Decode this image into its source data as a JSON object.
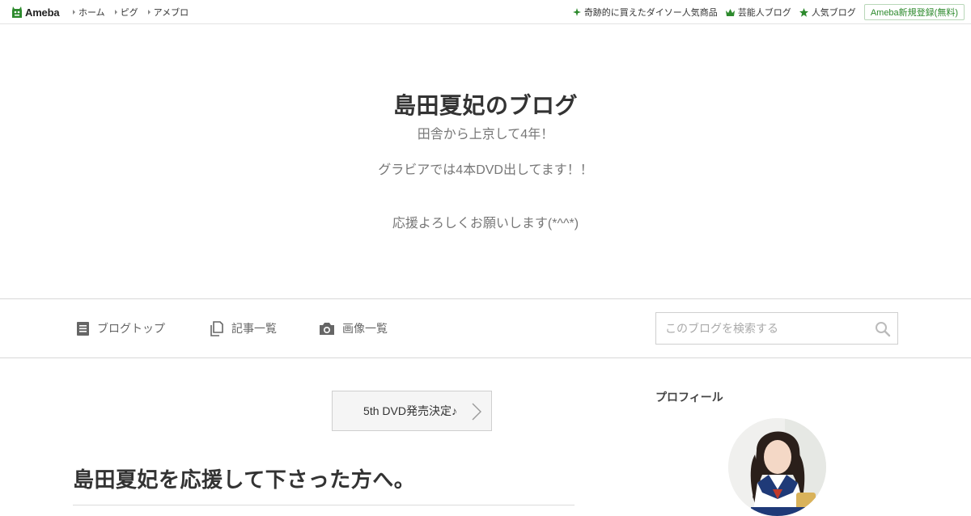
{
  "topbar": {
    "logo_text": "Ameba",
    "left_links": [
      "ホーム",
      "ピグ",
      "アメブロ"
    ],
    "right_links": [
      {
        "label": "奇跡的に買えたダイソー人気商品",
        "icon": "sparkle-icon"
      },
      {
        "label": "芸能人ブログ",
        "icon": "crown-icon"
      },
      {
        "label": "人気ブログ",
        "icon": "star-icon"
      }
    ],
    "register_label": "Ameba新規登録(無料)",
    "accent": "#2d8a2d"
  },
  "blog": {
    "title": "島田夏妃のブログ",
    "description": [
      "田舎から上京して4年！",
      "",
      "グラビアでは4本DVD出してます！！",
      "",
      "",
      "応援よろしくお願いします(*^^*)"
    ]
  },
  "blog_nav": {
    "items": [
      {
        "label": "ブログトップ",
        "icon": "document-icon"
      },
      {
        "label": "記事一覧",
        "icon": "copy-icon"
      },
      {
        "label": "画像一覧",
        "icon": "camera-icon"
      }
    ],
    "search_placeholder": "このブログを検索する"
  },
  "main": {
    "pinned_label": "5th DVD発売決定♪",
    "article_title": "島田夏妃を応援して下さった方へ。"
  },
  "sidebar": {
    "profile_heading": "プロフィール"
  }
}
